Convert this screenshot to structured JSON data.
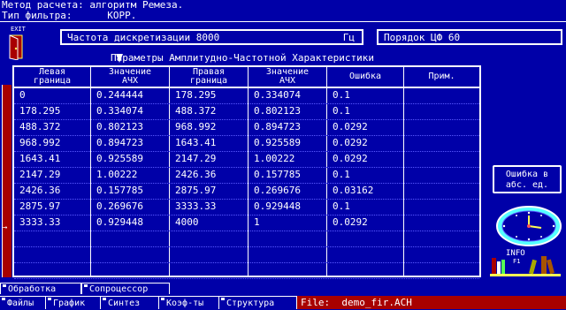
{
  "top": {
    "method_line": "Метод расчета: алгоритм Ремеза.",
    "filter_type_line": "Тип фильтра:      КОРР."
  },
  "exit_label": "EXIT",
  "sampling": {
    "label": "Частота дискретизации 8000",
    "unit": "Гц"
  },
  "order": {
    "label": "Порядок ЦФ 60"
  },
  "table_caption": "Параметры Амплитудно-Частотной Характеристики",
  "table": {
    "headers": [
      {
        "line1": "Левая",
        "line2": "граница"
      },
      {
        "line1": "Значение",
        "line2": "АЧХ"
      },
      {
        "line1": "Правая",
        "line2": "граница"
      },
      {
        "line1": "Значение",
        "line2": "АЧХ"
      },
      {
        "line1": "Ошибка",
        "line2": ""
      },
      {
        "line1": "Прим.",
        "line2": ""
      }
    ],
    "rows": [
      [
        "0",
        "0.244444",
        "178.295",
        "0.334074",
        "0.1",
        ""
      ],
      [
        "178.295",
        "0.334074",
        "488.372",
        "0.802123",
        "0.1",
        ""
      ],
      [
        "488.372",
        "0.802123",
        "968.992",
        "0.894723",
        "0.0292",
        ""
      ],
      [
        "968.992",
        "0.894723",
        "1643.41",
        "0.925589",
        "0.0292",
        ""
      ],
      [
        "1643.41",
        "0.925589",
        "2147.29",
        "1.00222",
        "0.0292",
        ""
      ],
      [
        "2147.29",
        "1.00222",
        "2426.36",
        "0.157785",
        "0.1",
        ""
      ],
      [
        "2426.36",
        "0.157785",
        "2875.97",
        "0.269676",
        "0.03162",
        ""
      ],
      [
        "2875.97",
        "0.269676",
        "3333.33",
        "0.929448",
        "0.1",
        ""
      ],
      [
        "3333.33",
        "0.929448",
        "4000",
        "1",
        "0.0292",
        ""
      ]
    ]
  },
  "error_button": {
    "line1": "Ошибка в",
    "line2": "абс. ед."
  },
  "info_label": "INFO",
  "info_sub": "F1",
  "tabs": {
    "processing": "Обработка",
    "coprocessor": "Сопроцессор"
  },
  "bottom_menu": [
    {
      "key": "F",
      "label": "Файлы"
    },
    {
      "key": "G",
      "label": "График"
    },
    {
      "key": "S",
      "label": "Синтез"
    },
    {
      "key": "K",
      "label": "Коэф-ты"
    },
    {
      "key": "S",
      "label": "Структура"
    }
  ],
  "file": "File:  demo_fir.ACH",
  "colors": {
    "background": "#0000a8",
    "status_red": "#a80000",
    "text": "#ffffff",
    "accent_yellow": "#ffff55"
  }
}
